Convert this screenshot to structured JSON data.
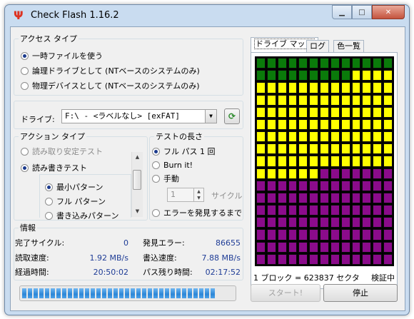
{
  "window": {
    "title": "Check Flash 1.16.2"
  },
  "access_type": {
    "legend": "アクセス タイプ",
    "options": [
      "一時ファイルを使う",
      "論理ドライブとして (NTベースのシステムのみ)",
      "物理デバイスとして (NTベースのシステムのみ)"
    ],
    "selected_index": 0
  },
  "drive": {
    "label": "ドライブ:",
    "value": "F:\\ - <ラベルなし> [exFAT]"
  },
  "action_type": {
    "legend": "アクション タイプ",
    "options": [
      "読み取り安定テスト",
      "読み書きテスト"
    ],
    "selected_index": 1,
    "patterns": [
      "最小パターン",
      "フル パターン",
      "書き込みパターン"
    ],
    "pattern_selected_index": 0
  },
  "test_length": {
    "legend": "テストの長さ",
    "options": [
      "フル パス 1 回",
      "Burn it!",
      "手動",
      "エラーを発見するまで"
    ],
    "selected_index": 0,
    "cycles_value": "1",
    "cycles_label": "サイクル"
  },
  "info": {
    "legend": "情報",
    "completed_cycles_label": "完了サイクル:",
    "completed_cycles_value": "0",
    "errors_found_label": "発見エラー:",
    "errors_found_value": "86655",
    "read_speed_label": "読取速度:",
    "read_speed_value": "1.92 MB/s",
    "write_speed_label": "書込速度:",
    "write_speed_value": "7.88 MB/s",
    "elapsed_label": "経過時間:",
    "elapsed_value": "20:50:02",
    "pass_remaining_label": "パス残り時間:",
    "pass_remaining_value": "02:17:52"
  },
  "progress": {
    "fraction": 0.92
  },
  "tabs": [
    "ドライブ マップ",
    "ログ",
    "色一覧"
  ],
  "drive_map": {
    "columns": 13,
    "rows": 17,
    "green_cells": 22,
    "yellow_cells": 101,
    "purple_cells": 98,
    "colors": {
      "green": "#0a7a0a",
      "yellow": "#ffff00",
      "purple": "#8b0b8b"
    },
    "block_size_text": "1 ブロック = 623837 セクタ",
    "status": "検証中"
  },
  "buttons": {
    "start": "スタート!",
    "stop": "停止"
  }
}
